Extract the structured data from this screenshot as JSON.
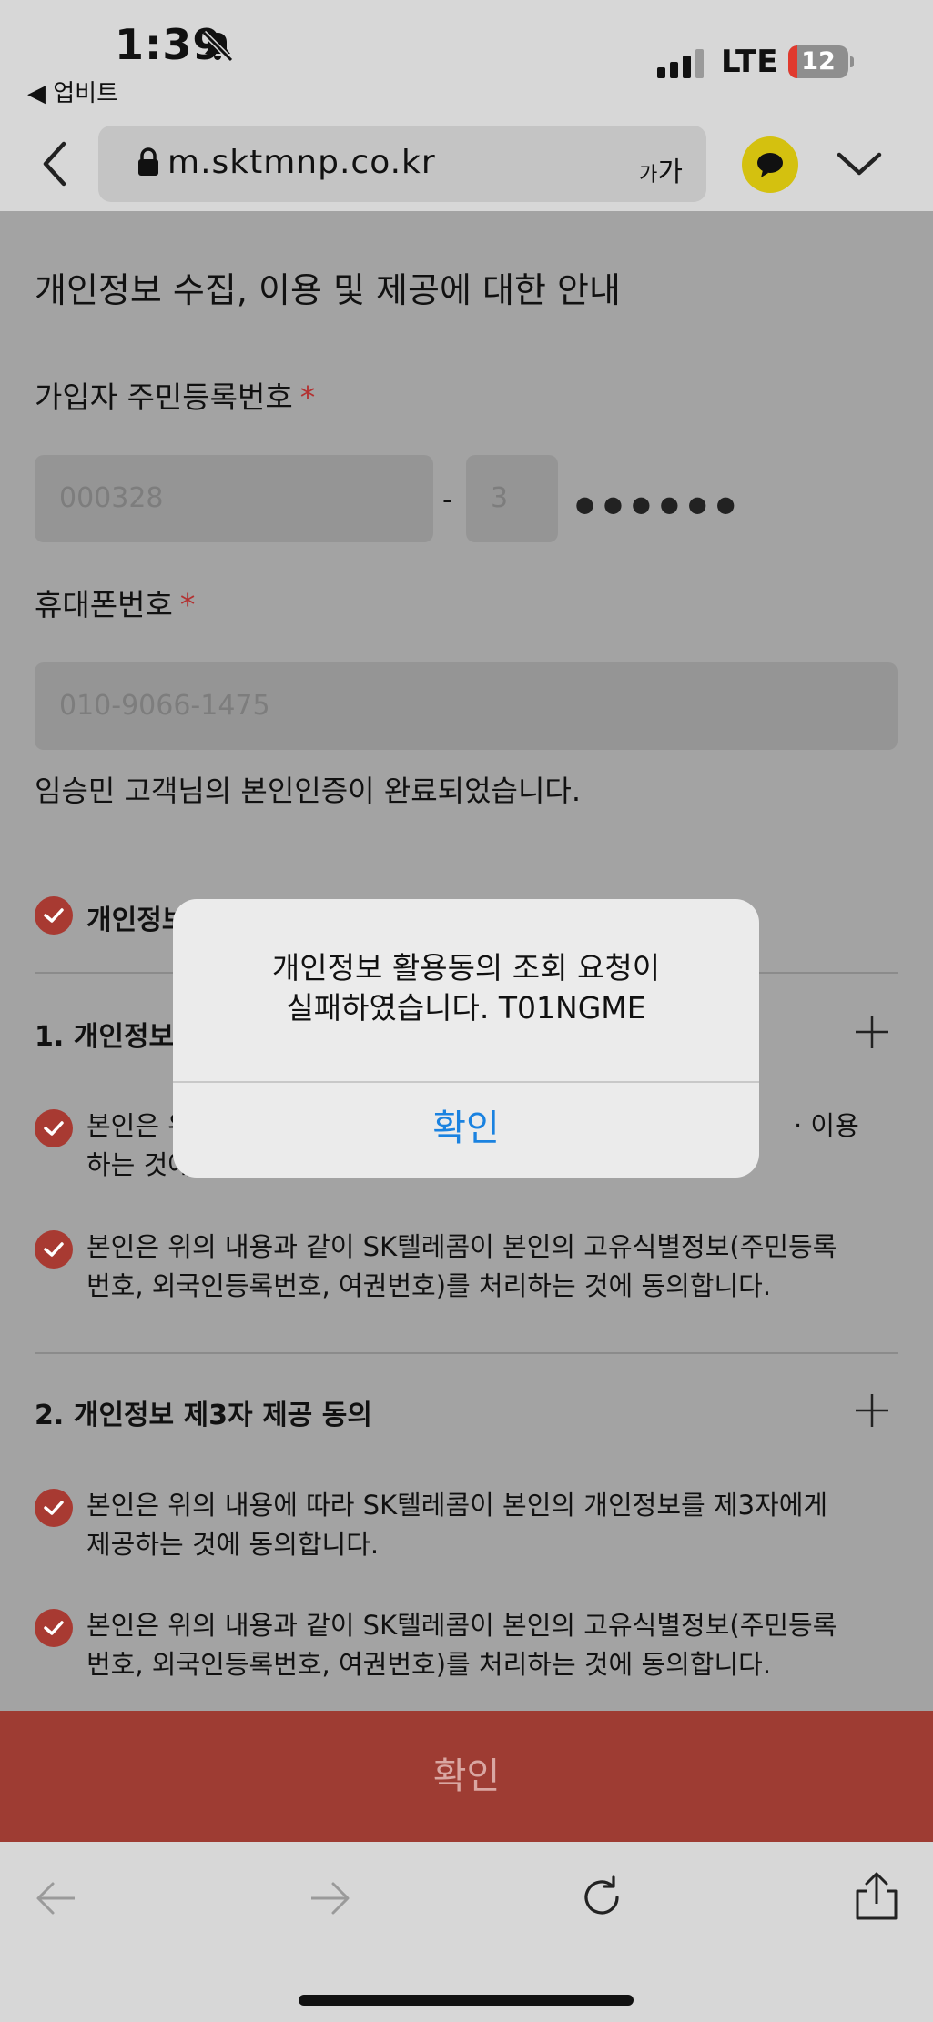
{
  "status_bar": {
    "time": "1:39",
    "back_app": "◀ 업비트",
    "network": "LTE",
    "battery": "12"
  },
  "browser": {
    "url": "m.sktmnp.co.kr",
    "text_size_small": "가",
    "text_size_large": "가"
  },
  "page": {
    "title": "개인정보 수집, 이용 및 제공에 대한 안내",
    "ssn_label": "가입자 주민등록번호",
    "required_mark": "*",
    "ssn_front": "000328",
    "ssn_separator": "-",
    "ssn_back_first": "3",
    "ssn_masked": "●●●●●●",
    "phone_label": "휴대폰번호",
    "phone_value": "010-9066-1475",
    "verify_message": "임승민 고객님의 본인인증이 완료되었습니다.",
    "agree_all": "개인정보",
    "section1": {
      "title": "1. 개인정보",
      "item1": "본인은 위",
      "item1_tail": "· 이용",
      "item1_line2": "하는 것에",
      "item2": "본인은 위의 내용과 같이 SK텔레콤이 본인의 고유식별정보(주민등록번호, 외국인등록번호, 여권번호)를 처리하는 것에 동의합니다."
    },
    "section2": {
      "title": "2. 개인정보 제3자 제공 동의",
      "item1": "본인은 위의 내용에 따라 SK텔레콤이 본인의 개인정보를 제3자에게 제공하는 것에 동의합니다.",
      "item2": "본인은 위의 내용과 같이 SK텔레콤이 본인의 고유식별정보(주민등록번호, 외국인등록번호, 여권번호)를 처리하는 것에 동의합니다."
    },
    "confirm_button": "확인"
  },
  "alert": {
    "message_line1": "개인정보 활용동의 조회 요청이",
    "message_line2": "실패하였습니다. T01NGME",
    "ok_button": "확인"
  },
  "colors": {
    "accent_red": "#a83a32",
    "alert_blue": "#1a82e0"
  },
  "icons": [
    "bell-slash-icon",
    "signal-icon",
    "lock-icon",
    "chat-bubble-icon",
    "chevron-down-icon",
    "plus-icon",
    "check-icon",
    "arrow-left-icon",
    "arrow-right-icon",
    "reload-icon",
    "share-icon"
  ]
}
